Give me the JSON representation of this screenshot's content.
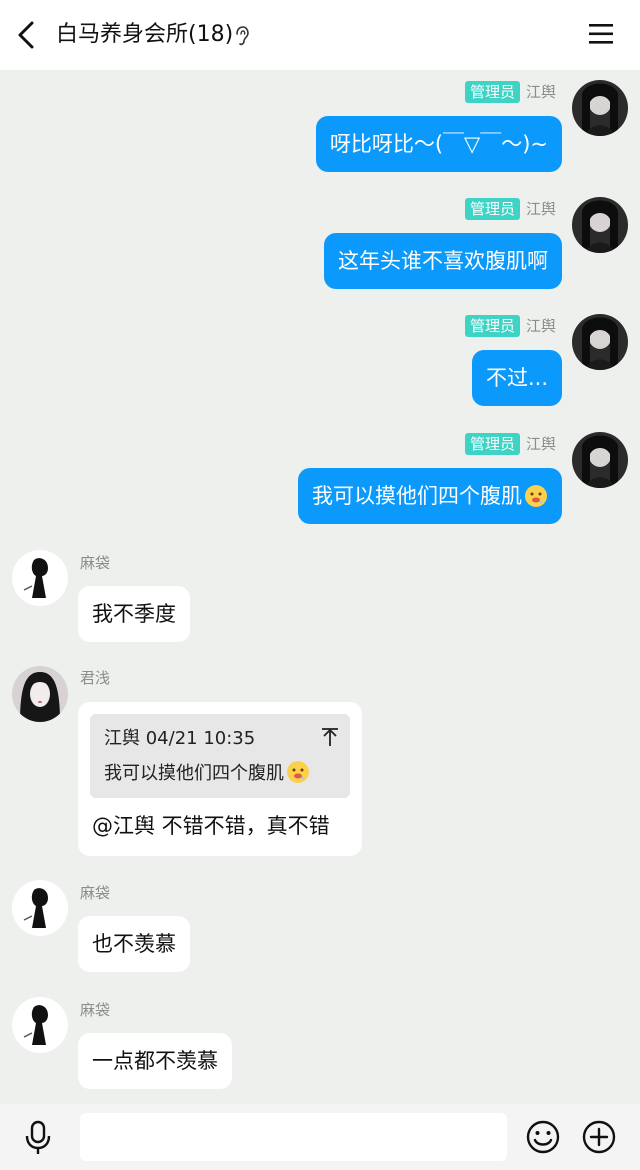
{
  "header": {
    "title": "白马养身会所(18)",
    "back_icon": "chevron-left-icon",
    "ear_icon": "ear-icon",
    "menu_icon": "hamburger-menu-icon"
  },
  "messages": [
    {
      "sender": "江舆",
      "role": "管理员",
      "side": "right",
      "text": "呀比呀比～(￣▽￣～)~"
    },
    {
      "sender": "江舆",
      "role": "管理员",
      "side": "right",
      "text": "这年头谁不喜欢腹肌啊"
    },
    {
      "sender": "江舆",
      "role": "管理员",
      "side": "right",
      "text": "不过..."
    },
    {
      "sender": "江舆",
      "role": "管理员",
      "side": "right",
      "text": "我可以摸他们四个腹肌",
      "emoji": "drooling-face-icon"
    },
    {
      "sender": "麻袋",
      "side": "left",
      "text": "我不季度"
    },
    {
      "sender": "君浅",
      "side": "left",
      "quote": {
        "meta": "江舆 04/21 10:35",
        "text": "我可以摸他们四个腹肌",
        "emoji": "drooling-face-icon",
        "jump_icon": "jump-to-message-icon"
      },
      "text": "@江舆 不错不错，真不错"
    },
    {
      "sender": "麻袋",
      "side": "left",
      "text": "也不羡慕"
    },
    {
      "sender": "麻袋",
      "side": "left",
      "text": "一点都不羡慕"
    }
  ],
  "input_bar": {
    "placeholder": "",
    "mic_icon": "microphone-icon",
    "emoji_icon": "smiley-icon",
    "plus_icon": "plus-circle-icon"
  },
  "colors": {
    "self_bubble": "#0b9afc",
    "admin_badge": "#3fd3c6",
    "chat_background": "#edf0ec"
  }
}
